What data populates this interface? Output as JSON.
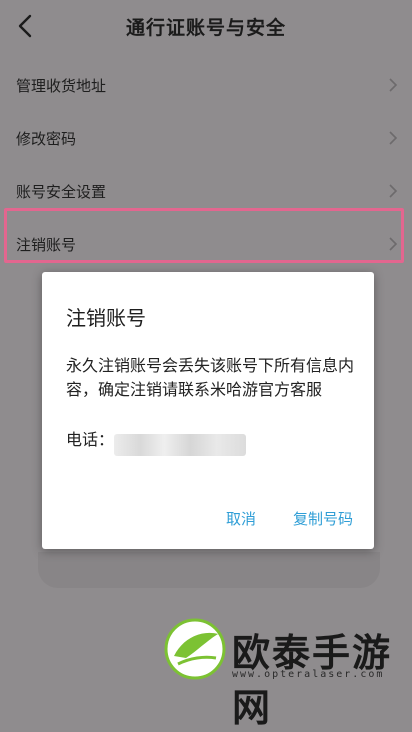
{
  "header": {
    "title": "通行证账号与安全"
  },
  "menu": {
    "items": [
      {
        "label": "管理收货地址"
      },
      {
        "label": "修改密码"
      },
      {
        "label": "账号安全设置"
      },
      {
        "label": "注销账号"
      }
    ]
  },
  "dialog": {
    "title": "注销账号",
    "message": "永久注销账号会丢失该账号下所有信息内容，确定注销请联系米哈游官方客服",
    "phone_label": "电话：",
    "cancel_label": "取消",
    "copy_label": "复制号码"
  },
  "watermark": {
    "text": "欧泰手游网",
    "url": "www.opteralaser.com"
  },
  "colors": {
    "overlay_bg": "#8f8c8e",
    "highlight": "#e3668f",
    "link": "#2f9ed6",
    "logo_green": "#7cc233"
  }
}
